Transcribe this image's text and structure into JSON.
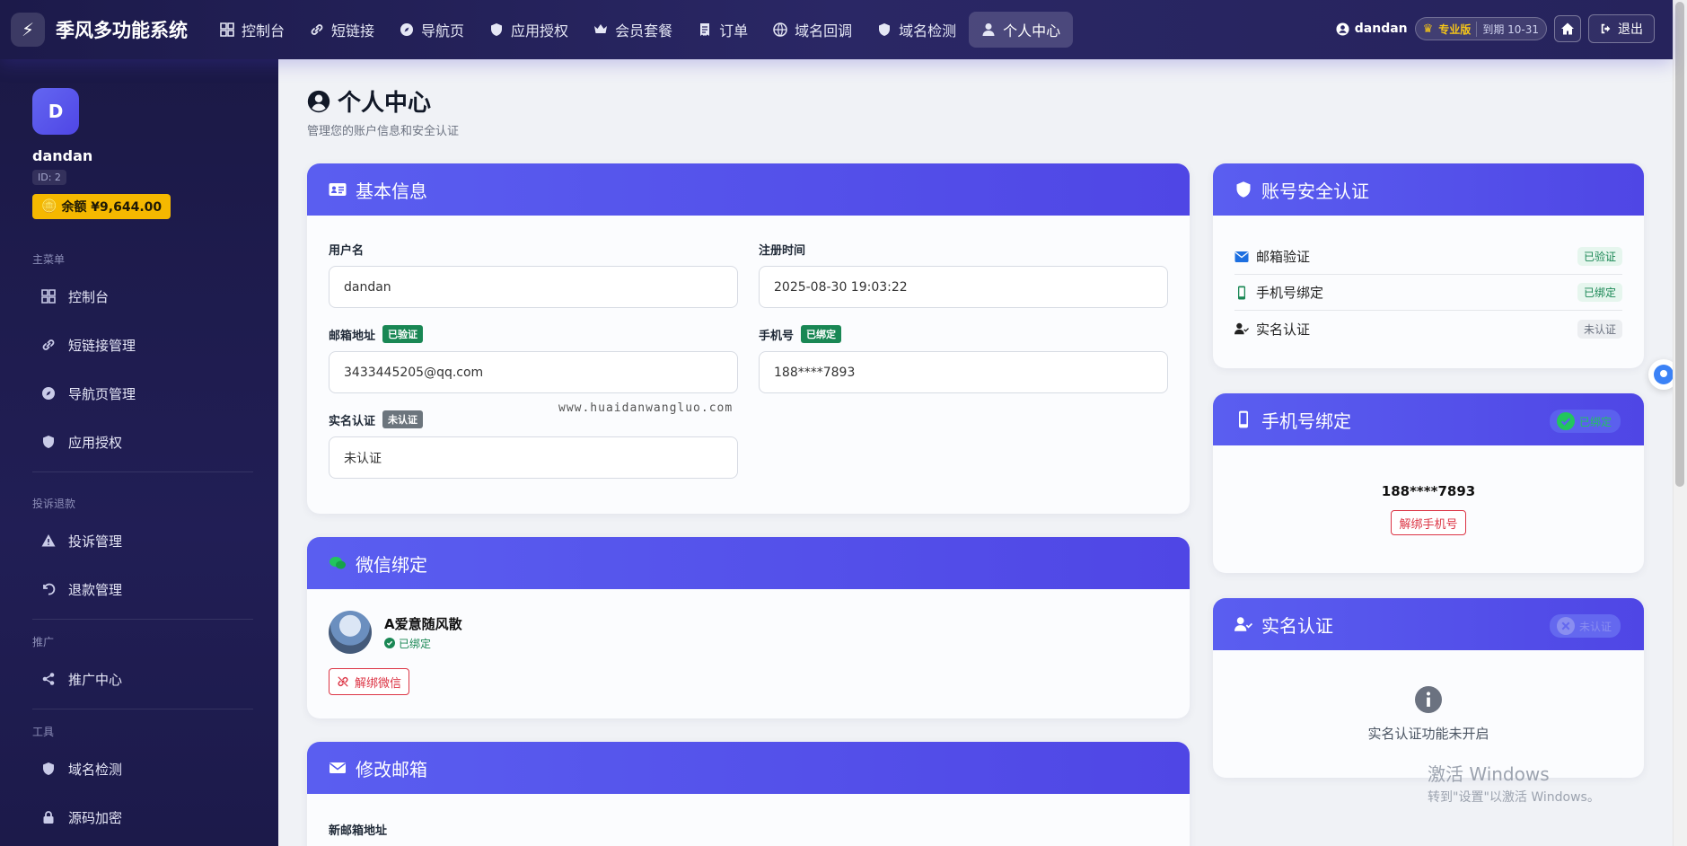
{
  "app": {
    "brand": "季风多功能系统"
  },
  "nav": [
    {
      "label": "控制台",
      "icon": "grid-icon"
    },
    {
      "label": "短链接",
      "icon": "link-icon"
    },
    {
      "label": "导航页",
      "icon": "compass-icon"
    },
    {
      "label": "应用授权",
      "icon": "shield-icon"
    },
    {
      "label": "会员套餐",
      "icon": "crown-icon"
    },
    {
      "label": "订单",
      "icon": "receipt-icon"
    },
    {
      "label": "域名回调",
      "icon": "globe-icon"
    },
    {
      "label": "域名检测",
      "icon": "shield-icon"
    },
    {
      "label": "个人中心",
      "icon": "user-icon",
      "active": true
    }
  ],
  "topbar": {
    "username": "dandan",
    "plan": "专业版",
    "expire": "到期 10-31",
    "logout": "退出"
  },
  "sidebar": {
    "avatar_letter": "D",
    "name": "dandan",
    "id_text": "ID: 2",
    "balance": "余额 ¥9,644.00",
    "sections": [
      {
        "title": "主菜单",
        "items": [
          "控制台",
          "短链接管理",
          "导航页管理",
          "应用授权"
        ]
      },
      {
        "title": "投诉退款",
        "items": [
          "投诉管理",
          "退款管理"
        ]
      },
      {
        "title": "推广",
        "items": [
          "推广中心"
        ]
      },
      {
        "title": "工具",
        "items": [
          "域名检测",
          "源码加密"
        ]
      }
    ]
  },
  "page": {
    "title": "个人中心",
    "subtitle": "管理您的账户信息和安全认证"
  },
  "basic": {
    "title": "基本信息",
    "username_label": "用户名",
    "username": "dandan",
    "reg_label": "注册时间",
    "reg_time": "2025-08-30 19:03:22",
    "email_label": "邮箱地址",
    "email_badge": "已验证",
    "email": "3433445205@qq.com",
    "phone_label": "手机号",
    "phone_badge": "已绑定",
    "phone": "188****7893",
    "realname_label": "实名认证",
    "realname_badge": "未认证",
    "realname": "未认证"
  },
  "wechat": {
    "title": "微信绑定",
    "nickname": "A爱意随风散",
    "status": "已绑定",
    "unbind": "解绑微信"
  },
  "email_change": {
    "title": "修改邮箱",
    "new_label": "新邮箱地址"
  },
  "security": {
    "title": "账号安全认证",
    "rows": [
      {
        "label": "邮箱验证",
        "status": "已验证"
      },
      {
        "label": "手机号绑定",
        "status": "已绑定"
      },
      {
        "label": "实名认证",
        "status": "未认证"
      }
    ]
  },
  "phone_bind": {
    "title": "手机号绑定",
    "pill": "已绑定",
    "number": "188****7893",
    "unbind": "解绑手机号"
  },
  "realname": {
    "title": "实名认证",
    "pill": "未认证",
    "message": "实名认证功能未开启"
  },
  "watermark": {
    "url": "www.huaidanwangluo.com",
    "win_title": "激活 Windows",
    "win_sub": "转到\"设置\"以激活 Windows。"
  },
  "colors": {
    "accent": "#4f46e5",
    "nav_bg": "#1c1a4a",
    "success": "#198754",
    "danger": "#dc3545",
    "balance": "#f5b800"
  }
}
